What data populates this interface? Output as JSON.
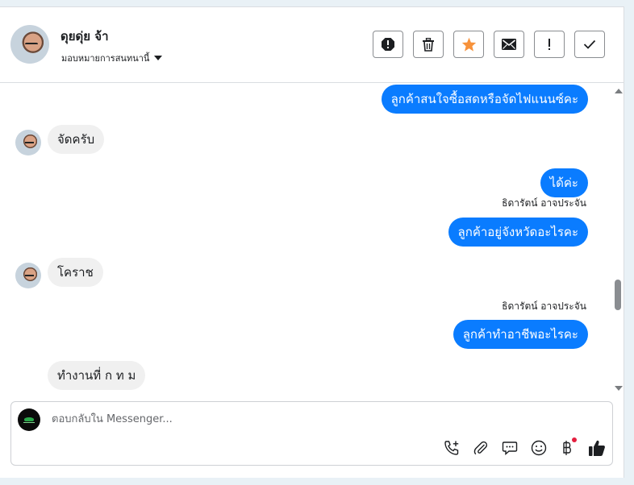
{
  "header": {
    "contact_name": "ดุยดุ่ย จ้า",
    "assign_label": "มอบหมายการสนทนานี้",
    "actions": [
      {
        "name": "mark-spam",
        "icon": "alert-octagon-icon"
      },
      {
        "name": "delete",
        "icon": "trash-icon"
      },
      {
        "name": "star",
        "icon": "star-icon"
      },
      {
        "name": "mark-unread",
        "icon": "envelope-icon"
      },
      {
        "name": "follow-up",
        "icon": "exclamation-icon"
      },
      {
        "name": "mark-done",
        "icon": "check-icon"
      }
    ]
  },
  "messages": [
    {
      "direction": "out",
      "text": "ลูกค้าสนใจซื้อสดหรือจัดไฟแนนซ์คะ"
    },
    {
      "direction": "in",
      "text": "จัดครับ"
    },
    {
      "direction": "out",
      "text": "ได้ค่ะ"
    },
    {
      "direction": "out",
      "sender": "ธิดารัตน์ อาจประจัน",
      "text": "ลูกค้าอยู่จังหวัดอะไรคะ"
    },
    {
      "direction": "in",
      "text": "โคราช"
    },
    {
      "direction": "out",
      "sender": "ธิดารัตน์ อาจประจัน",
      "text": "ลูกค้าทำอาชีพอะไรคะ"
    },
    {
      "direction": "in",
      "text": "ทำงานที่ ก ท ม"
    }
  ],
  "composer": {
    "placeholder": "ตอบกลับใน Messenger...",
    "tools": [
      "call-add-icon",
      "paperclip-icon",
      "chat-bubble-icon",
      "emoji-icon",
      "baht-icon",
      "thumbs-up-icon"
    ]
  },
  "colors": {
    "outgoing_bubble": "#0a7cff",
    "incoming_bubble": "#f0f0f0",
    "star": "#f7923b",
    "notification_dot": "#e41e3f"
  }
}
